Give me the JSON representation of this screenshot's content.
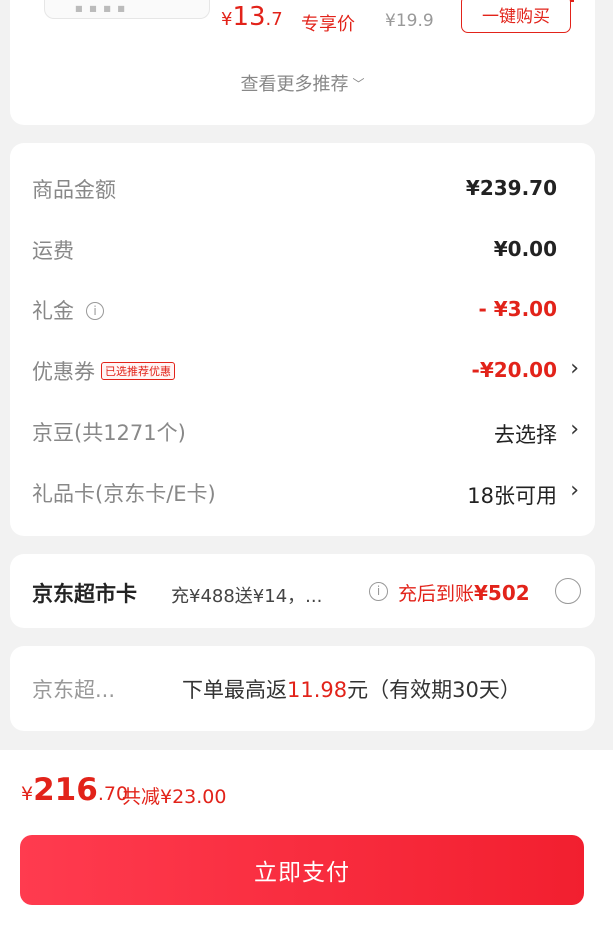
{
  "recommend": {
    "thumb_marks": "■ ■ ■ ■",
    "price_currency": "¥",
    "price_int": "13",
    "price_dec": ".7",
    "exclusive_label": "专享价",
    "original_price": "¥19.9",
    "buy_button": "一键购买",
    "more_label": "查看更多推荐",
    "more_icon": "chevron-down-icon"
  },
  "summary": {
    "rows": [
      {
        "label": "商品金额",
        "value": "¥239.70"
      },
      {
        "label": "运费",
        "value": "¥0.00"
      },
      {
        "label": "礼金",
        "value": "- ¥3.00",
        "icon": "info-icon"
      },
      {
        "label": "优惠券",
        "tag": "已选推荐优惠",
        "value": "-¥20.00"
      },
      {
        "label": "京豆(共1271个)",
        "value": "去选择"
      },
      {
        "label": "礼品卡(京东卡/E卡)",
        "value": "18张可用"
      }
    ],
    "arrow_glyph": "›"
  },
  "supermarket_card": {
    "title": "京东超市卡",
    "description": "充¥488送¥14，...",
    "reward_prefix": "充后到账",
    "reward_amount": "¥502"
  },
  "rebate": {
    "label": "京东超...",
    "text_prefix": "下单最高返",
    "amount": "11.98",
    "text_suffix": "元（有效期30天）"
  },
  "footer": {
    "total_currency": "¥",
    "total_int": "216",
    "total_dec": ".70",
    "saved_text": "共减¥23.00",
    "pay_button": "立即支付"
  },
  "colors": {
    "accent": "#e2231a",
    "pay_button": "#f52a3a",
    "background": "#f2f2f2"
  }
}
